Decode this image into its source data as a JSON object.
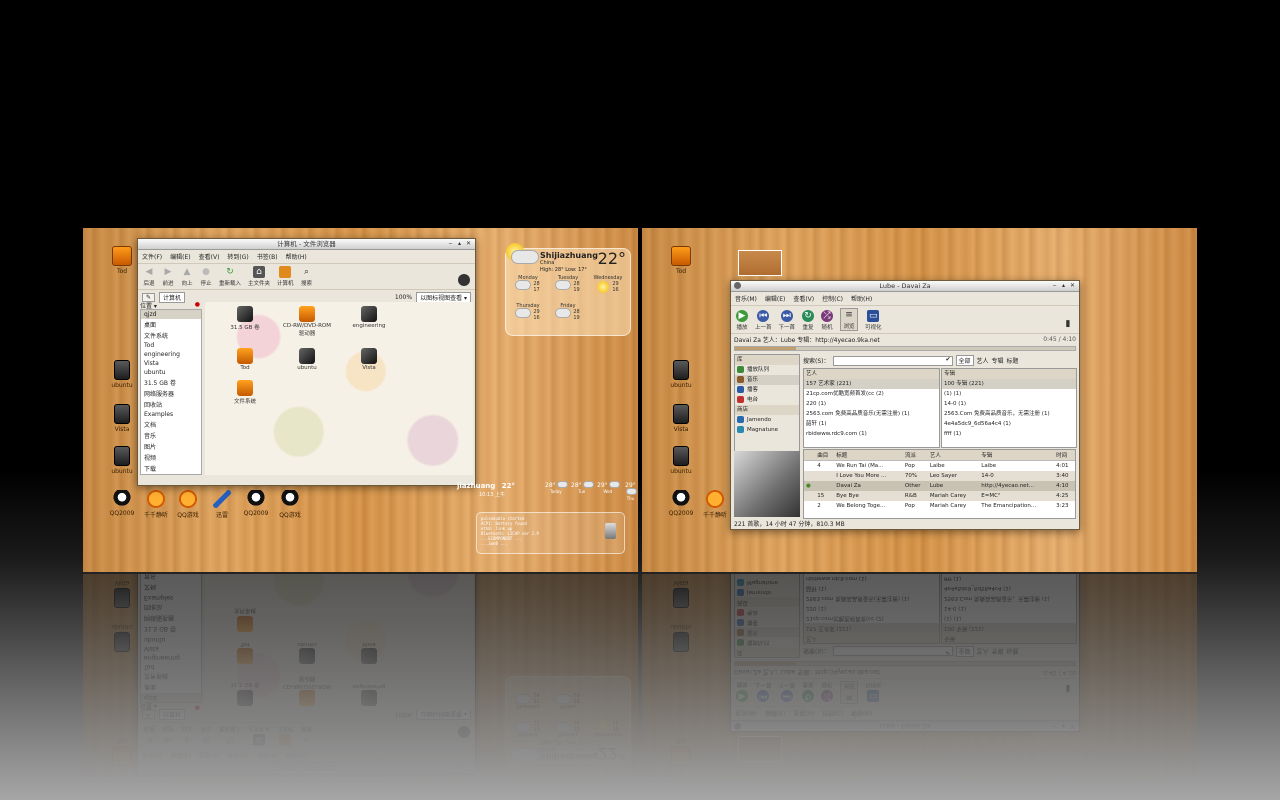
{
  "desktop_left": {
    "icons": [
      {
        "label": "Tod",
        "icon": "package-icon"
      },
      {
        "label": "ubuntu",
        "icon": "drive-icon"
      },
      {
        "label": "Vista",
        "icon": "drive-icon"
      },
      {
        "label": "ubuntu",
        "icon": "drive-icon"
      }
    ],
    "dock": [
      {
        "label": "QQ2009",
        "icon": "qq-icon"
      },
      {
        "label": "千千静听",
        "icon": "ttplayer-icon"
      },
      {
        "label": "QQ游戏",
        "icon": "orange-icon"
      },
      {
        "label": "迅雷",
        "icon": "arrow-icon"
      },
      {
        "label": "QQ2009",
        "icon": "qq-icon"
      },
      {
        "label": "QQ游戏",
        "icon": "qq-icon"
      }
    ]
  },
  "file_manager": {
    "title": "计算机 - 文件浏览器",
    "menu": [
      "文件(F)",
      "编辑(E)",
      "查看(V)",
      "转到(G)",
      "书签(B)",
      "帮助(H)"
    ],
    "toolbar": [
      "后退",
      "前进",
      "向上",
      "停止",
      "重新载入",
      "主文件夹",
      "计算机",
      "搜索"
    ],
    "location_button": "计算机",
    "zoom": "100%",
    "view_mode": "以图标视图查看",
    "side_pane_title": "位置",
    "places": [
      "qjzd",
      "桌面",
      "文件系统",
      "Tod",
      "engineering",
      "Vista",
      "ubuntu",
      "31.5 GB 卷",
      "网络服务器",
      "回收站",
      "Examples",
      "文档",
      "音乐",
      "图片",
      "视频",
      "下载"
    ],
    "items": [
      {
        "label": "31.5 GB 卷",
        "icon": "drive-icon"
      },
      {
        "label": "CD-RW/DVD-ROM 驱动器",
        "icon": "package-icon"
      },
      {
        "label": "engineering",
        "icon": "drive-icon"
      },
      {
        "label": "Tod",
        "icon": "package-icon"
      },
      {
        "label": "ubuntu",
        "icon": "drive-icon"
      },
      {
        "label": "Vista",
        "icon": "drive-icon"
      },
      {
        "label": "文件系统",
        "icon": "package-icon"
      }
    ]
  },
  "weather": {
    "city": "Shijiazhuang",
    "country": "China",
    "temp": "22°",
    "high_low": "High: 28°  Low: 17°",
    "days": [
      {
        "name": "Monday",
        "hi": "28",
        "lo": "17"
      },
      {
        "name": "Tuesday",
        "hi": "28",
        "lo": "19"
      },
      {
        "name": "Wednesday",
        "hi": "29",
        "lo": "16"
      },
      {
        "name": "Thursday",
        "hi": "29",
        "lo": "16"
      },
      {
        "name": "Friday",
        "hi": "28",
        "lo": "19"
      }
    ]
  },
  "weather_small": {
    "city": "jiazhuang",
    "temp": "22°",
    "time": "10:13 上午",
    "forecast": [
      {
        "temp": "28°",
        "day": "Today"
      },
      {
        "temp": "28°",
        "day": "Tue"
      },
      {
        "temp": "29°",
        "day": "Wed"
      },
      {
        "temp": "29°",
        "day": "Thu"
      }
    ]
  },
  "terminal_lines": [
    "pulseaudio started",
    "ACPI: Battery found",
    "eth0: link up",
    "Bluetooth: L2CAP ver 2.9",
    "...ECOMPONENT ...",
    "...3ae8 ..."
  ],
  "desktop_right": {
    "icons": [
      {
        "label": "Tod",
        "icon": "package-icon"
      },
      {
        "label": "ubuntu",
        "icon": "drive-icon"
      },
      {
        "label": "Vista",
        "icon": "drive-icon"
      },
      {
        "label": "ubuntu",
        "icon": "drive-icon"
      }
    ],
    "dock": [
      {
        "label": "QQ2009",
        "icon": "qq-icon"
      },
      {
        "label": "千千静听",
        "icon": "ttplayer-icon"
      }
    ]
  },
  "player": {
    "title": "Lube - Davai Za",
    "menu": [
      "音乐(M)",
      "编辑(E)",
      "查看(V)",
      "控制(C)",
      "帮助(H)"
    ],
    "toolbar": [
      "播放",
      "上一首",
      "下一首",
      "重复",
      "随机",
      "浏览",
      "可视化"
    ],
    "now_playing": "Davai Za 艺人：Lube 专辑：http://4yecao.9ka.net",
    "time": "0:45 / 4:10",
    "search_label": "搜索(S)：",
    "filter_tabs": [
      "全部",
      "艺人",
      "专辑",
      "标题"
    ],
    "sources": [
      {
        "label": "播放队列",
        "icon": "queue-icon"
      },
      {
        "label": "音乐",
        "icon": "music-icon"
      },
      {
        "label": "播客",
        "icon": "podcast-icon"
      },
      {
        "label": "电台",
        "icon": "radio-icon"
      },
      {
        "label": "Jamendo",
        "icon": "jamendo-icon"
      },
      {
        "label": "Magnatune",
        "icon": "magnatune-icon"
      }
    ],
    "sources_header": "库",
    "stores_header": "商店",
    "artist_col": "艺人",
    "artists": [
      "157 艺术家 (221)",
      "21cp.com优酷宽频首发(cc (2)",
      "220 (1)",
      "2563.com 免费高品质音乐(无需注册) (1)",
      "韶轩 (1)",
      "rbidwww.rdc9.com (1)"
    ],
    "album_col": "专辑",
    "albums": [
      "100 专辑 (221)",
      "(1) (1)",
      "14-0 (1)",
      "2563.Com 免费高品质音乐，无需注册 (1)",
      "4e4a5dc9_6d56a4c4 (1)",
      "ffff (1)"
    ],
    "columns": [
      "曲目",
      "标题",
      "流派",
      "艺人",
      "专辑",
      "时间"
    ],
    "tracks": [
      {
        "n": "4",
        "t": "We Run Tai (Ma...",
        "g": "Pop",
        "a": "Laibe",
        "al": "Laibe",
        "d": "4:01"
      },
      {
        "n": "",
        "t": "I Love You More ...",
        "g": "70%",
        "a": "Leo Sayer",
        "al": "14-0",
        "d": "3:40"
      },
      {
        "n": "",
        "t": "Davai Za",
        "g": "Other",
        "a": "Lube",
        "al": "http://4yecao.net...",
        "d": "4:10"
      },
      {
        "n": "15",
        "t": "Bye Bye",
        "g": "R&B",
        "a": "Mariah Carey",
        "al": "E=MC²",
        "d": "4:25"
      },
      {
        "n": "2",
        "t": "We Belong Toge...",
        "g": "Pop",
        "a": "Mariah Carey",
        "al": "The Emancipation...",
        "d": "3:23"
      }
    ],
    "status": "221 首歌，14 小时 47 分钟，810.3 MB"
  }
}
